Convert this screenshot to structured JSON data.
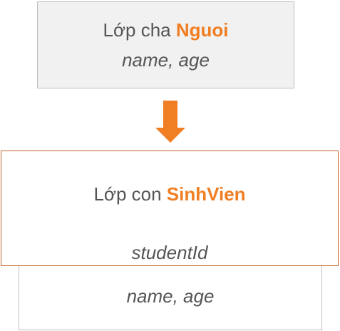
{
  "colors": {
    "accent": "#f07e22",
    "child_border": "#c1652d",
    "text": "#555555",
    "parent_fill": "#f1f1f1"
  },
  "parent": {
    "prefix": "Lớp cha ",
    "class_name": "Nguoi",
    "fields": "name, age"
  },
  "arrow": {
    "icon": "down-arrow-icon"
  },
  "child": {
    "prefix": "Lớp con ",
    "class_name": "SinhVien",
    "own_fields": "studentId",
    "inherited_fields": "name, age"
  }
}
